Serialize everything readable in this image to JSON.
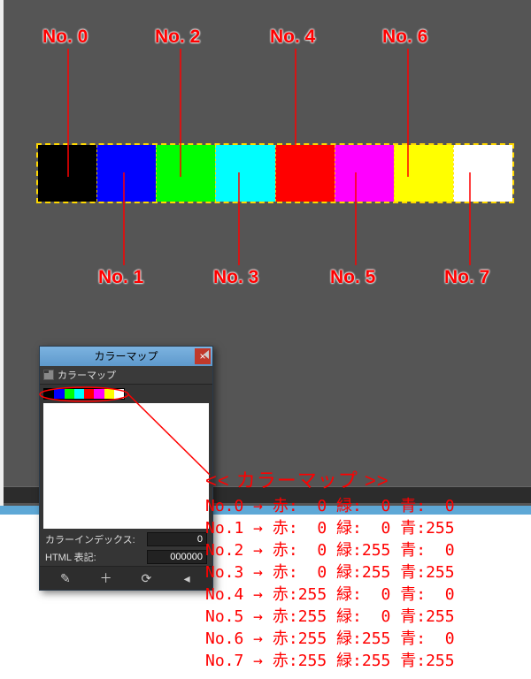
{
  "swatches": [
    {
      "label": "No. 0",
      "color": "#000000"
    },
    {
      "label": "No. 1",
      "color": "#0000ff"
    },
    {
      "label": "No. 2",
      "color": "#00ff00"
    },
    {
      "label": "No. 3",
      "color": "#00ffff"
    },
    {
      "label": "No. 4",
      "color": "#ff0000"
    },
    {
      "label": "No. 5",
      "color": "#ff00ff"
    },
    {
      "label": "No. 6",
      "color": "#ffff00"
    },
    {
      "label": "No. 7",
      "color": "#ffffff"
    }
  ],
  "dialog": {
    "title": "カラーマップ",
    "close": "×",
    "sub_header": "カラーマップ",
    "index_label": "カラーインデックス:",
    "index_value": "0",
    "html_label": "HTML 表記:",
    "html_value": "000000"
  },
  "annotation": {
    "title": "<< カラーマップ >>",
    "rows": [
      {
        "no": "No.0",
        "r": "0",
        "g": "0",
        "b": "0"
      },
      {
        "no": "No.1",
        "r": "0",
        "g": "0",
        "b": "255"
      },
      {
        "no": "No.2",
        "r": "0",
        "g": "255",
        "b": "0"
      },
      {
        "no": "No.3",
        "r": "0",
        "g": "255",
        "b": "255"
      },
      {
        "no": "No.4",
        "r": "255",
        "g": "0",
        "b": "0"
      },
      {
        "no": "No.5",
        "r": "255",
        "g": "0",
        "b": "255"
      },
      {
        "no": "No.6",
        "r": "255",
        "g": "255",
        "b": "0"
      },
      {
        "no": "No.7",
        "r": "255",
        "g": "255",
        "b": "255"
      }
    ],
    "labels": {
      "r": "赤:",
      "g": "緑:",
      "b": "青:",
      "arrow": "→"
    }
  }
}
